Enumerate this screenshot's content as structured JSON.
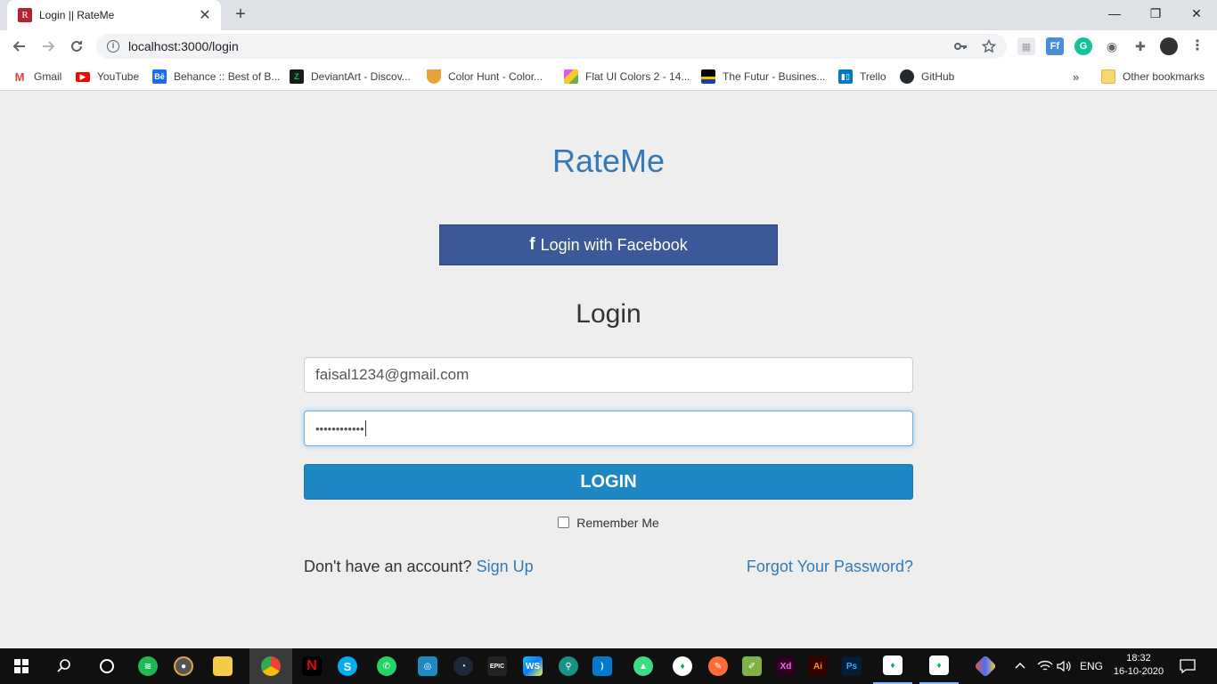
{
  "browser": {
    "tab_title": "Login || RateMe",
    "tab_favicon_letter": "R",
    "new_tab_symbol": "+",
    "close_symbol": "✕",
    "url": "localhost:3000/login",
    "window_controls": {
      "minimize": "—",
      "maximize": "❐",
      "close": "✕"
    }
  },
  "bookmarks": [
    {
      "label": "Gmail",
      "icon": "gmail-icon",
      "color": "#ea4335"
    },
    {
      "label": "YouTube",
      "icon": "youtube-icon",
      "color": "#ff0000"
    },
    {
      "label": "Behance :: Best of B...",
      "icon": "behance-icon",
      "color": "#1769ff"
    },
    {
      "label": "DeviantArt - Discov...",
      "icon": "deviantart-icon",
      "color": "#05cc47"
    },
    {
      "label": "Color Hunt - Color...",
      "icon": "colorhunt-icon",
      "color": "#e8a33d"
    },
    {
      "label": "Flat UI Colors 2 - 14...",
      "icon": "flatuicolors-icon",
      "color": "#e056fd"
    },
    {
      "label": "The Futur - Busines...",
      "icon": "futur-icon",
      "color": "#000000"
    },
    {
      "label": "Trello",
      "icon": "trello-icon",
      "color": "#0079bf"
    },
    {
      "label": "GitHub",
      "icon": "github-icon",
      "color": "#24292e"
    }
  ],
  "bookmarks_overflow": "»",
  "other_bookmarks": "Other bookmarks",
  "page": {
    "brand": "RateMe",
    "facebook_button": "Login with Facebook",
    "facebook_glyph": "f",
    "heading": "Login",
    "email_value": "faisal1234@gmail.com",
    "password_value": "••••••••••••",
    "login_button": "LOGIN",
    "remember_label": "Remember Me",
    "no_account_text": "Don't have an account?",
    "signup_link": "Sign Up",
    "forgot_link": "Forgot Your Password?"
  },
  "taskbar": {
    "language": "ENG",
    "time": "18:32",
    "date": "16-10-2020"
  },
  "colors": {
    "brand": "#337ab7",
    "facebook": "#3b5998",
    "login_button": "#1e88c4",
    "page_bg": "#eeeeee"
  }
}
